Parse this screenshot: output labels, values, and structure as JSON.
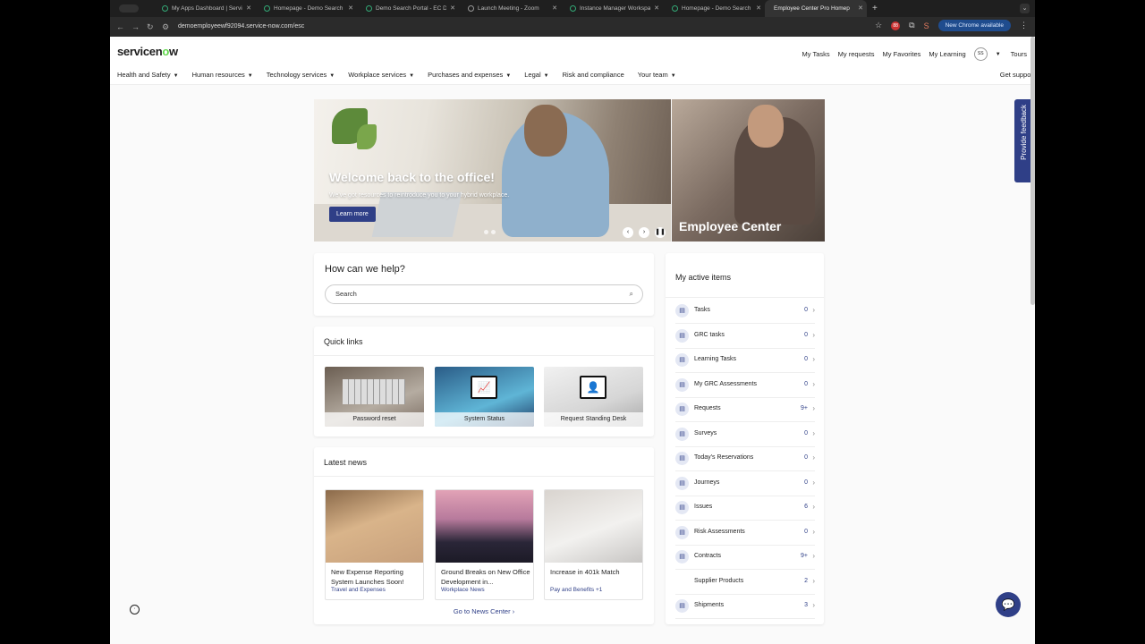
{
  "browser": {
    "tabs": [
      {
        "title": "My Apps Dashboard | Servic"
      },
      {
        "title": "Homepage - Demo Search Po"
      },
      {
        "title": "Demo Search Portal - EC De"
      },
      {
        "title": "Launch Meeting - Zoom"
      },
      {
        "title": "Instance Manager Workspace"
      },
      {
        "title": "Homepage - Demo Search Po"
      },
      {
        "title": "Employee Center Pro Homep"
      }
    ],
    "url": "demoemployeewf92094.service-now.com/esc",
    "chrome_available": "New Chrome available",
    "icons": [
      "back-icon",
      "forward-icon",
      "reload-icon",
      "site-info-icon",
      "star-icon",
      "extension-icon",
      "profile-icon",
      "menu-icon"
    ]
  },
  "header": {
    "logo": {
      "part1": "servicen",
      "dot": "o",
      "part2": "w"
    },
    "toplinks": [
      "My Tasks",
      "My requests",
      "My Favorites",
      "My Learning"
    ],
    "avatar": "SS",
    "tours": "Tours",
    "menu": [
      "Health and Safety",
      "Human resources",
      "Technology services",
      "Workplace services",
      "Purchases and expenses",
      "Legal",
      "Risk and compliance",
      "Your team"
    ],
    "menu_has_dropdown": [
      true,
      true,
      true,
      true,
      true,
      true,
      false,
      true
    ],
    "get_support": "Get support"
  },
  "hero": {
    "title": "Welcome back to the office!",
    "subtitle": "We've got resources to reintroduce you to your hybrid workplace.",
    "button": "Learn more",
    "side_title": "Employee Center"
  },
  "help": {
    "title": "How can we help?",
    "search_placeholder": "Search"
  },
  "quick_links": {
    "title": "Quick links",
    "items": [
      "Password reset",
      "System Status",
      "Request Standing Desk"
    ]
  },
  "news": {
    "title": "Latest news",
    "items": [
      {
        "title": "New Expense Reporting System Launches Soon!",
        "category": "Travel and Expenses"
      },
      {
        "title": "Ground Breaks on New Office Development in...",
        "category": "Workplace News"
      },
      {
        "title": "Increase in 401k Match",
        "category": "Pay and Benefits +1"
      }
    ],
    "goto": "Go to News Center"
  },
  "active": {
    "title": "My active items",
    "items": [
      {
        "label": "Tasks",
        "count": "0",
        "icon": "task-icon"
      },
      {
        "label": "GRC tasks",
        "count": "0",
        "icon": "grc-icon"
      },
      {
        "label": "Learning Tasks",
        "count": "0",
        "icon": "learning-icon"
      },
      {
        "label": "My GRC Assessments",
        "count": "0",
        "icon": "assessment-icon"
      },
      {
        "label": "Requests",
        "count": "9+",
        "icon": "request-icon"
      },
      {
        "label": "Surveys",
        "count": "0",
        "icon": "survey-icon"
      },
      {
        "label": "Today's Reservations",
        "count": "0",
        "icon": "reservation-icon"
      },
      {
        "label": "Journeys",
        "count": "0",
        "icon": "journey-icon"
      },
      {
        "label": "Issues",
        "count": "6",
        "icon": "issue-icon"
      },
      {
        "label": "Risk Assessments",
        "count": "0",
        "icon": "risk-icon"
      },
      {
        "label": "Contracts",
        "count": "9+",
        "icon": "contract-icon"
      },
      {
        "label": "Supplier Products",
        "count": "2",
        "icon": ""
      },
      {
        "label": "Shipments",
        "count": "3",
        "icon": "shipment-icon"
      }
    ]
  },
  "feedback": "Provide feedback",
  "colors": {
    "brand": "#2f3f87",
    "logo_dot": "#62d84e"
  }
}
